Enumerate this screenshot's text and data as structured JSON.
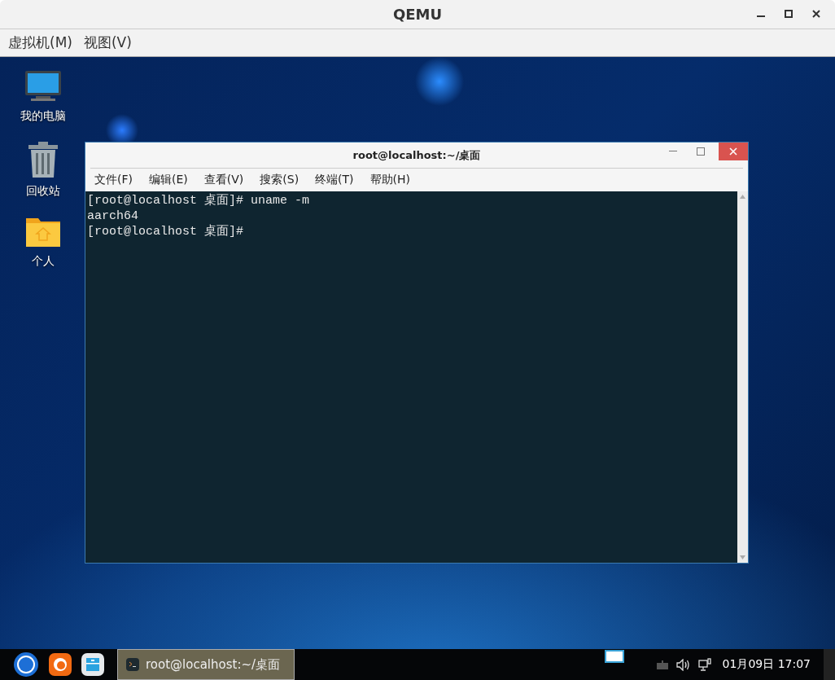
{
  "window": {
    "title": "QEMU"
  },
  "menu": [
    "虚拟机(M)",
    "视图(V)"
  ],
  "desktop_icons": [
    {
      "label": "我的电脑",
      "kind": "computer"
    },
    {
      "label": "回收站",
      "kind": "trash"
    },
    {
      "label": "个人",
      "kind": "folder"
    }
  ],
  "terminal": {
    "title": "root@localhost:~/桌面",
    "menu": [
      "文件(F)",
      "编辑(E)",
      "查看(V)",
      "搜索(S)",
      "终端(T)",
      "帮助(H)"
    ],
    "lines": [
      "[root@localhost 桌面]# uname -m",
      "aarch64",
      "[root@localhost 桌面]#"
    ]
  },
  "taskbar": {
    "tasks": [
      {
        "label": "root@localhost:~/桌面",
        "selected": true
      }
    ],
    "clock": "01月09日 17:07"
  }
}
